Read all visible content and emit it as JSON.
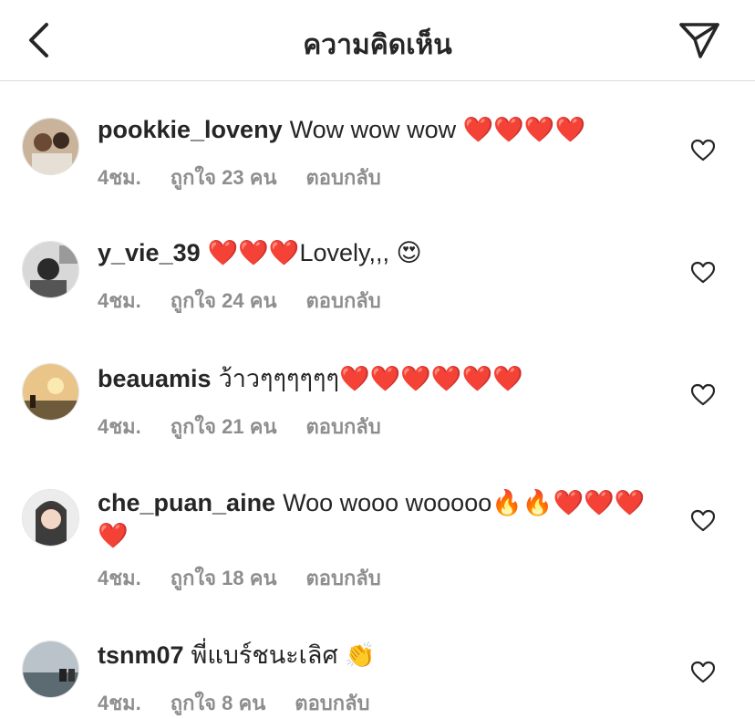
{
  "header": {
    "title": "ความคิดเห็น"
  },
  "comments": [
    {
      "username": "pookkie_loveny",
      "text": "Wow wow wow ❤️❤️❤️❤️",
      "time": "4ชม.",
      "likes": "ถูกใจ 23 คน",
      "reply": "ตอบกลับ"
    },
    {
      "username": "y_vie_39",
      "text": "❤️❤️❤️Lovely,,, 😍",
      "time": "4ชม.",
      "likes": "ถูกใจ 24 คน",
      "reply": "ตอบกลับ"
    },
    {
      "username": "beauamis",
      "text": "ว้าวๆๆๆๆๆๆ❤️❤️❤️❤️❤️❤️",
      "time": "4ชม.",
      "likes": "ถูกใจ 21 คน",
      "reply": "ตอบกลับ"
    },
    {
      "username": "che_puan_aine",
      "text": "Woo wooo wooooo🔥🔥❤️❤️❤️❤️",
      "time": "4ชม.",
      "likes": "ถูกใจ 18 คน",
      "reply": "ตอบกลับ"
    },
    {
      "username": "tsnm07",
      "text": "พี่แบร์ชนะเลิศ 👏",
      "time": "4ชม.",
      "likes": "ถูกใจ 8 คน",
      "reply": "ตอบกลับ"
    }
  ]
}
